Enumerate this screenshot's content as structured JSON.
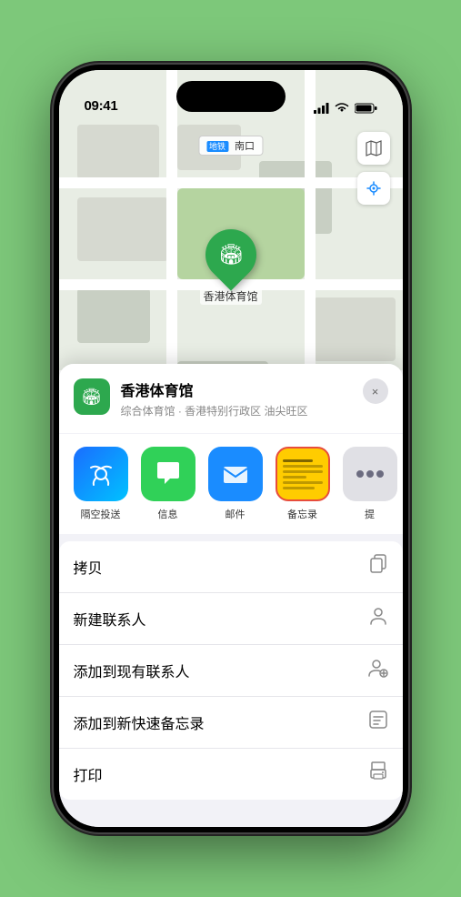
{
  "statusBar": {
    "time": "09:41",
    "timeArrow": "▶"
  },
  "mapLabel": "南口",
  "mapLabelIcon": "地铁",
  "mapControls": {
    "mapIcon": "🗺",
    "locationIcon": "↗"
  },
  "marker": {
    "label": "香港体育馆"
  },
  "venueHeader": {
    "name": "香港体育馆",
    "subtitle": "综合体育馆 · 香港特别行政区 油尖旺区",
    "closeLabel": "×"
  },
  "shareItems": [
    {
      "id": "airdrop",
      "label": "隔空投送",
      "type": "airdrop"
    },
    {
      "id": "messages",
      "label": "信息",
      "type": "messages"
    },
    {
      "id": "mail",
      "label": "邮件",
      "type": "mail"
    },
    {
      "id": "notes",
      "label": "备忘录",
      "type": "notes"
    },
    {
      "id": "more",
      "label": "提",
      "type": "more"
    }
  ],
  "actionItems": [
    {
      "id": "copy",
      "label": "拷贝",
      "icon": "copy"
    },
    {
      "id": "new-contact",
      "label": "新建联系人",
      "icon": "person"
    },
    {
      "id": "add-existing",
      "label": "添加到现有联系人",
      "icon": "person-add"
    },
    {
      "id": "add-notes",
      "label": "添加到新快速备忘录",
      "icon": "note"
    },
    {
      "id": "print",
      "label": "打印",
      "icon": "print"
    }
  ]
}
